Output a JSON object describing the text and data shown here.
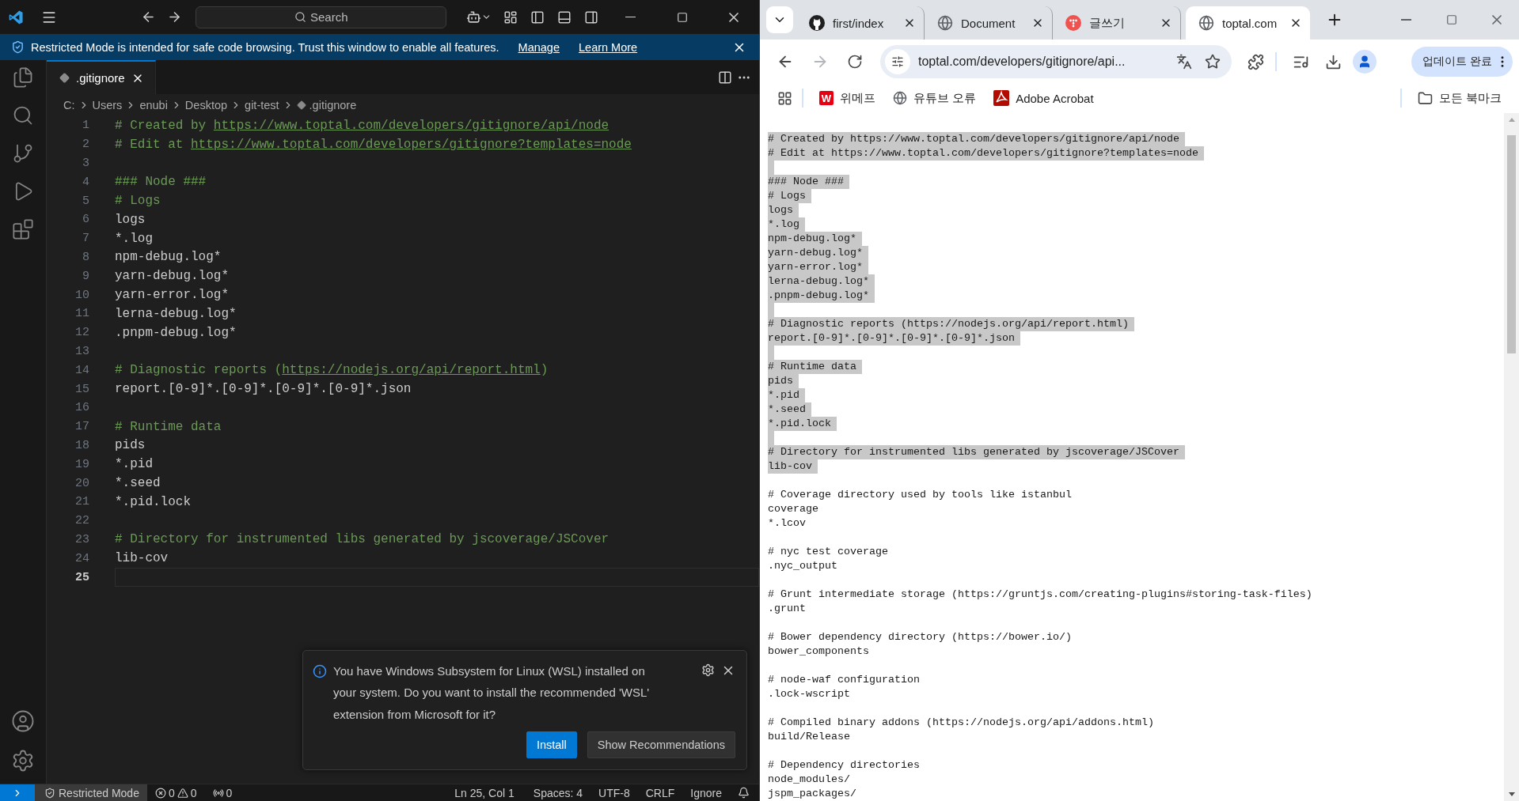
{
  "vscode": {
    "search": {
      "label": "Search"
    },
    "banner": {
      "message": "Restricted Mode is intended for safe code browsing. Trust this window to enable all features.",
      "links": [
        "Manage",
        "Learn More"
      ]
    },
    "tabs": [
      {
        "label": ".gitignore",
        "selected": true
      }
    ],
    "breadcrumbs": [
      "C:",
      "Users",
      "enubi",
      "Desktop",
      "git-test",
      ".gitignore"
    ],
    "lines": [
      {
        "number": "1",
        "kind": "comment",
        "text": "# Created by ",
        "link": "https://www.toptal.com/developers/gitignore/api/node",
        "current": false
      },
      {
        "number": "2",
        "kind": "comment",
        "text": "# Edit at ",
        "link": "https://www.toptal.com/developers/gitignore?templates=node",
        "current": false
      },
      {
        "number": "3",
        "kind": "blank",
        "current": false
      },
      {
        "number": "4",
        "kind": "comment",
        "text": "### Node ###",
        "current": false
      },
      {
        "number": "5",
        "kind": "comment",
        "text": "# Logs",
        "current": false
      },
      {
        "number": "6",
        "kind": "code",
        "text": "logs",
        "current": false
      },
      {
        "number": "7",
        "kind": "code",
        "text": "*.log",
        "current": false
      },
      {
        "number": "8",
        "kind": "code",
        "text": "npm-debug.log*",
        "current": false
      },
      {
        "number": "9",
        "kind": "code",
        "text": "yarn-debug.log*",
        "current": false
      },
      {
        "number": "10",
        "kind": "code",
        "text": "yarn-error.log*",
        "current": false
      },
      {
        "number": "11",
        "kind": "code",
        "text": "lerna-debug.log*",
        "current": false
      },
      {
        "number": "12",
        "kind": "code",
        "text": ".pnpm-debug.log*",
        "current": false
      },
      {
        "number": "13",
        "kind": "blank",
        "current": false
      },
      {
        "number": "14",
        "kind": "comment",
        "text": "# Diagnostic reports (",
        "link": "https://nodejs.org/api/report.html",
        "after": ")",
        "current": false
      },
      {
        "number": "15",
        "kind": "code",
        "text": "report.[0-9]*.[0-9]*.[0-9]*.[0-9]*.json",
        "current": false
      },
      {
        "number": "16",
        "kind": "blank",
        "current": false
      },
      {
        "number": "17",
        "kind": "comment",
        "text": "# Runtime data",
        "current": false
      },
      {
        "number": "18",
        "kind": "code",
        "text": "pids",
        "current": false
      },
      {
        "number": "19",
        "kind": "code",
        "text": "*.pid",
        "current": false
      },
      {
        "number": "20",
        "kind": "code",
        "text": "*.seed",
        "current": false
      },
      {
        "number": "21",
        "kind": "code",
        "text": "*.pid.lock",
        "current": false
      },
      {
        "number": "22",
        "kind": "blank",
        "current": false
      },
      {
        "number": "23",
        "kind": "comment",
        "text": "# Directory for instrumented libs generated by jscoverage/JSCover",
        "current": false
      },
      {
        "number": "24",
        "kind": "code",
        "text": "lib-cov",
        "current": false
      },
      {
        "number": "25",
        "kind": "blank",
        "current": true
      }
    ],
    "notification": {
      "message": "You have Windows Subsystem for Linux (WSL) installed on your system. Do you want to install the recommended 'WSL' extension from Microsoft for it?",
      "buttons": [
        {
          "label": "Install",
          "kind": "primary"
        },
        {
          "label": "Show Recommendations",
          "kind": "secondary"
        }
      ]
    },
    "status_bar": {
      "mode": "Restricted Mode",
      "errors": "0",
      "warnings": "0",
      "ports": "0",
      "items": [
        "Ln 25, Col 1",
        "Spaces: 4",
        "UTF-8",
        "CRLF",
        "Ignore"
      ]
    }
  },
  "browser": {
    "tabs": [
      {
        "title": "first/index",
        "kind": "github",
        "selected": false
      },
      {
        "title": "Document",
        "kind": "globe",
        "selected": false
      },
      {
        "title": "글쓰기",
        "kind": "circle",
        "selected": false
      },
      {
        "title": "toptal.com",
        "kind": "globe",
        "selected": true
      }
    ],
    "nav": [
      {
        "kind": "back",
        "disabled": false
      },
      {
        "kind": "forward",
        "disabled": true
      },
      {
        "kind": "reload",
        "disabled": false
      }
    ],
    "address": "toptal.com/developers/gitignore/api...",
    "update_button": "업데이트 완료",
    "bookmarks": [
      {
        "label": "위메프",
        "kind": "letter",
        "badge": "W"
      },
      {
        "label": "유튜브 오류",
        "kind": "globe"
      },
      {
        "label": "Adobe Acrobat",
        "kind": "pdf"
      }
    ],
    "all_bookmarks": "모든 북마크",
    "page_lines": [
      {
        "kind": "text",
        "text": "# Created by https://www.toptal.com/developers/gitignore/api/node",
        "selected": true
      },
      {
        "kind": "text",
        "text": "# Edit at https://www.toptal.com/developers/gitignore?templates=node",
        "selected": true
      },
      {
        "kind": "blank",
        "selected": true
      },
      {
        "kind": "text",
        "text": "### Node ###",
        "selected": true
      },
      {
        "kind": "text",
        "text": "# Logs",
        "selected": true
      },
      {
        "kind": "text",
        "text": "logs",
        "selected": true
      },
      {
        "kind": "text",
        "text": "*.log",
        "selected": true
      },
      {
        "kind": "text",
        "text": "npm-debug.log*",
        "selected": true
      },
      {
        "kind": "text",
        "text": "yarn-debug.log*",
        "selected": true
      },
      {
        "kind": "text",
        "text": "yarn-error.log*",
        "selected": true
      },
      {
        "kind": "text",
        "text": "lerna-debug.log*",
        "selected": true
      },
      {
        "kind": "text",
        "text": ".pnpm-debug.log*",
        "selected": true
      },
      {
        "kind": "blank",
        "selected": true
      },
      {
        "kind": "text",
        "text": "# Diagnostic reports (https://nodejs.org/api/report.html)",
        "selected": true
      },
      {
        "kind": "text",
        "text": "report.[0-9]*.[0-9]*.[0-9]*.[0-9]*.json",
        "selected": true
      },
      {
        "kind": "blank",
        "selected": true
      },
      {
        "kind": "text",
        "text": "# Runtime data",
        "selected": true
      },
      {
        "kind": "text",
        "text": "pids",
        "selected": true
      },
      {
        "kind": "text",
        "text": "*.pid",
        "selected": true
      },
      {
        "kind": "text",
        "text": "*.seed",
        "selected": true
      },
      {
        "kind": "text",
        "text": "*.pid.lock",
        "selected": true
      },
      {
        "kind": "blank",
        "selected": true
      },
      {
        "kind": "text",
        "text": "# Directory for instrumented libs generated by jscoverage/JSCover",
        "selected": true
      },
      {
        "kind": "text",
        "text": "lib-cov",
        "selected": true
      },
      {
        "kind": "blank",
        "selected": false
      },
      {
        "kind": "text",
        "text": "# Coverage directory used by tools like istanbul",
        "selected": false
      },
      {
        "kind": "text",
        "text": "coverage",
        "selected": false
      },
      {
        "kind": "text",
        "text": "*.lcov",
        "selected": false
      },
      {
        "kind": "blank",
        "selected": false
      },
      {
        "kind": "text",
        "text": "# nyc test coverage",
        "selected": false
      },
      {
        "kind": "text",
        "text": ".nyc_output",
        "selected": false
      },
      {
        "kind": "blank",
        "selected": false
      },
      {
        "kind": "text",
        "text": "# Grunt intermediate storage (https://gruntjs.com/creating-plugins#storing-task-files)",
        "selected": false
      },
      {
        "kind": "text",
        "text": ".grunt",
        "selected": false
      },
      {
        "kind": "blank",
        "selected": false
      },
      {
        "kind": "text",
        "text": "# Bower dependency directory (https://bower.io/)",
        "selected": false
      },
      {
        "kind": "text",
        "text": "bower_components",
        "selected": false
      },
      {
        "kind": "blank",
        "selected": false
      },
      {
        "kind": "text",
        "text": "# node-waf configuration",
        "selected": false
      },
      {
        "kind": "text",
        "text": ".lock-wscript",
        "selected": false
      },
      {
        "kind": "blank",
        "selected": false
      },
      {
        "kind": "text",
        "text": "# Compiled binary addons (https://nodejs.org/api/addons.html)",
        "selected": false
      },
      {
        "kind": "text",
        "text": "build/Release",
        "selected": false
      },
      {
        "kind": "blank",
        "selected": false
      },
      {
        "kind": "text",
        "text": "# Dependency directories",
        "selected": false
      },
      {
        "kind": "text",
        "text": "node_modules/",
        "selected": false
      },
      {
        "kind": "text",
        "text": "jspm_packages/",
        "selected": false
      }
    ]
  }
}
